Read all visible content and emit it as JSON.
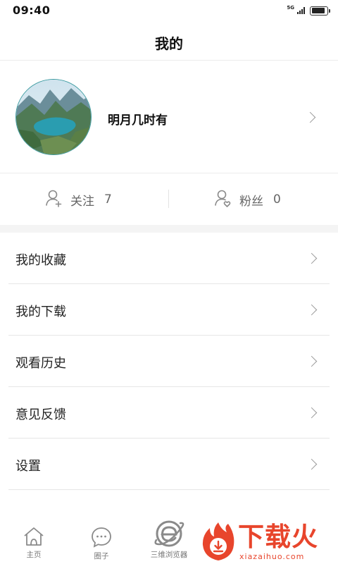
{
  "status_bar": {
    "time": "09:40",
    "network": "5G",
    "signal_icon": "signal-icon",
    "battery_icon": "battery-icon",
    "battery_level": 0.9
  },
  "header": {
    "title": "我的"
  },
  "profile": {
    "avatar_icon": "landscape-avatar-icon",
    "username": "明月几时有",
    "chevron_icon": "chevron-right-icon"
  },
  "stats": {
    "following": {
      "icon": "user-add-icon",
      "label": "关注",
      "value": "7"
    },
    "fans": {
      "icon": "user-heart-icon",
      "label": "粉丝",
      "value": "0"
    }
  },
  "menu": {
    "items": [
      {
        "label": "我的收藏",
        "icon": "chevron-right-icon"
      },
      {
        "label": "我的下载",
        "icon": "chevron-right-icon"
      },
      {
        "label": "观看历史",
        "icon": "chevron-right-icon"
      },
      {
        "label": "意见反馈",
        "icon": "chevron-right-icon"
      },
      {
        "label": "设置",
        "icon": "chevron-right-icon"
      }
    ]
  },
  "tabbar": {
    "tabs": [
      {
        "label": "主页",
        "icon": "home-icon"
      },
      {
        "label": "圈子",
        "icon": "chat-bubble-icon"
      },
      {
        "label": "三维浏览器",
        "icon": "browser-e-icon"
      }
    ]
  },
  "watermark": {
    "logo_icon": "flame-logo-icon",
    "text": "下载火",
    "site": "xiazaihuo.com"
  },
  "colors": {
    "accent_watermark": "#e8452c",
    "text_primary": "#222222",
    "text_secondary": "#666666",
    "divider": "#ececec"
  }
}
